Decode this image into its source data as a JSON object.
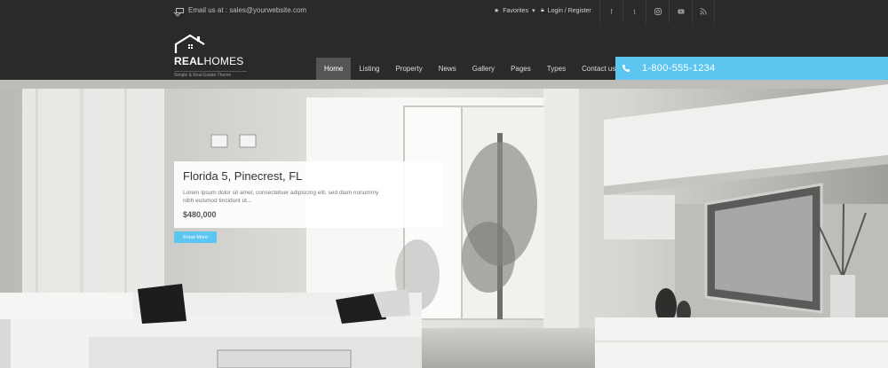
{
  "topbar": {
    "email": "Email us at : sales@yourwebsite.com",
    "favorites": "Favorites",
    "login": "Login / Register",
    "social_icons": [
      "facebook-icon",
      "twitter-icon",
      "instagram-icon",
      "youtube-icon",
      "rss-icon"
    ]
  },
  "logo": {
    "name_bold": "REAL",
    "name_light": "HOMES",
    "tagline": "Simple & Real Estate Theme"
  },
  "nav": {
    "items": [
      "Home",
      "Listing",
      "Property",
      "News",
      "Gallery",
      "Pages",
      "Types",
      "Contact us"
    ],
    "active": "Home"
  },
  "phone": {
    "number": "1-800-555-1234"
  },
  "feature": {
    "title": "Florida 5, Pinecrest, FL",
    "description": "Lorem ipsum dolor sit amet, consectetuer adipiscing elit, sed diam nonummy nibh euismod tincidunt ut...",
    "price": "$480,000",
    "more_label": "Know More"
  },
  "colors": {
    "accent": "#5cc6f0",
    "header_bg": "#2a2a2a",
    "nav_active_bg": "#555555"
  }
}
